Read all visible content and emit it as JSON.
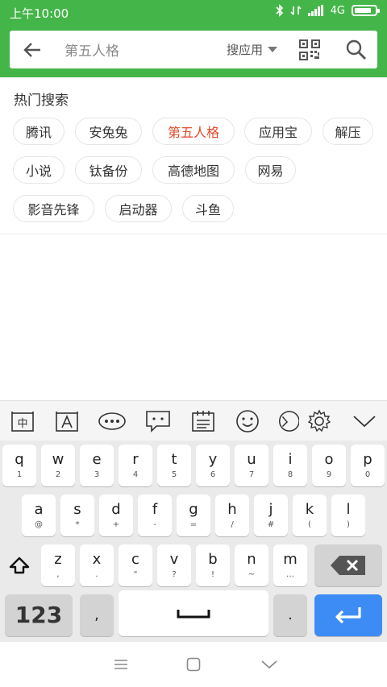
{
  "status": {
    "time": "上午10:00",
    "network": "4G"
  },
  "search": {
    "query": "第五人格",
    "scope": "搜应用"
  },
  "hot": {
    "title": "热门搜索",
    "chips": [
      "腾讯",
      "安兔兔",
      "第五人格",
      "应用宝",
      "解压",
      "小说",
      "钛备份",
      "高德地图",
      "网易",
      "影音先锋",
      "启动器",
      "斗鱼"
    ],
    "highlight": "第五人格"
  },
  "keyboard": {
    "row1": [
      [
        "q",
        "1"
      ],
      [
        "w",
        "2"
      ],
      [
        "e",
        "3"
      ],
      [
        "r",
        "4"
      ],
      [
        "t",
        "5"
      ],
      [
        "y",
        "6"
      ],
      [
        "u",
        "7"
      ],
      [
        "i",
        "8"
      ],
      [
        "o",
        "9"
      ],
      [
        "p",
        "0"
      ]
    ],
    "row2": [
      [
        "a",
        "@"
      ],
      [
        "s",
        "*"
      ],
      [
        "d",
        "+"
      ],
      [
        "f",
        "-"
      ],
      [
        "g",
        "="
      ],
      [
        "h",
        "/"
      ],
      [
        "j",
        "#"
      ],
      [
        "k",
        "("
      ],
      [
        "l",
        ")"
      ]
    ],
    "row3": [
      [
        "z",
        ","
      ],
      [
        "x",
        "."
      ],
      [
        "c",
        "\""
      ],
      [
        "v",
        "?"
      ],
      [
        "b",
        "!"
      ],
      [
        "n",
        "~"
      ],
      [
        "m",
        "…"
      ]
    ],
    "numbers_label": "123",
    "comma_label": ",",
    "period_label": "."
  },
  "colors": {
    "brand": "#44b549",
    "highlight": "#e6492c",
    "enter": "#3d8bf5"
  }
}
